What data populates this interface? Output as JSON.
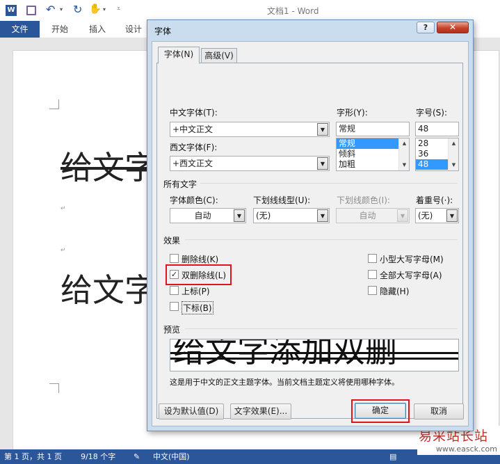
{
  "word": {
    "title": "文档1 - Word",
    "tabs": [
      "文件",
      "开始",
      "插入",
      "设计"
    ],
    "doc_lines": [
      "给文字",
      "给文字"
    ],
    "status": {
      "page": "第 1 页，共 1 页",
      "words": "9/18 个字",
      "lang": "中文(中国)"
    }
  },
  "dialog": {
    "title": "字体",
    "help": "?",
    "close": "✕",
    "tabs": [
      "字体(N)",
      "高级(V)"
    ],
    "labels": {
      "cn_font": "中文字体(T):",
      "style": "字形(Y):",
      "size": "字号(S):",
      "west_font": "西文字体(F):",
      "all_text": "所有文字",
      "font_color": "字体颜色(C):",
      "underline": "下划线线型(U):",
      "underline_color": "下划线颜色(I):",
      "emphasis": "着重号(·):",
      "effects": "效果",
      "preview": "预览"
    },
    "values": {
      "cn_font": "+中文正文",
      "west_font": "+西文正文",
      "style": "常规",
      "size": "48",
      "font_color": "自动",
      "underline": "(无)",
      "underline_color": "自动",
      "emphasis": "(无)"
    },
    "style_list": [
      "常规",
      "倾斜",
      "加粗"
    ],
    "size_list": [
      "28",
      "36",
      "48"
    ],
    "effects_left": [
      {
        "label": "删除线(K)",
        "checked": false
      },
      {
        "label": "双删除线(L)",
        "checked": true
      },
      {
        "label": "上标(P)",
        "checked": false
      },
      {
        "label": "下标(B)",
        "checked": false
      }
    ],
    "effects_right": [
      {
        "label": "小型大写字母(M)",
        "checked": false
      },
      {
        "label": "全部大写字母(A)",
        "checked": false
      },
      {
        "label": "隐藏(H)",
        "checked": false
      }
    ],
    "preview_text": "给文字添加双删",
    "preview_note": "这是用于中文的正文主题字体。当前文档主题定义将使用哪种字体。",
    "buttons": {
      "default": "设为默认值(D)",
      "effects": "文字效果(E)...",
      "ok": "确定",
      "cancel": "取消"
    },
    "checkmark": "✓"
  },
  "watermark": {
    "text": "易采站长站",
    "url": "www.easck.com"
  },
  "colors": {
    "accent": "#2b579a",
    "highlight": "#e0141b"
  }
}
